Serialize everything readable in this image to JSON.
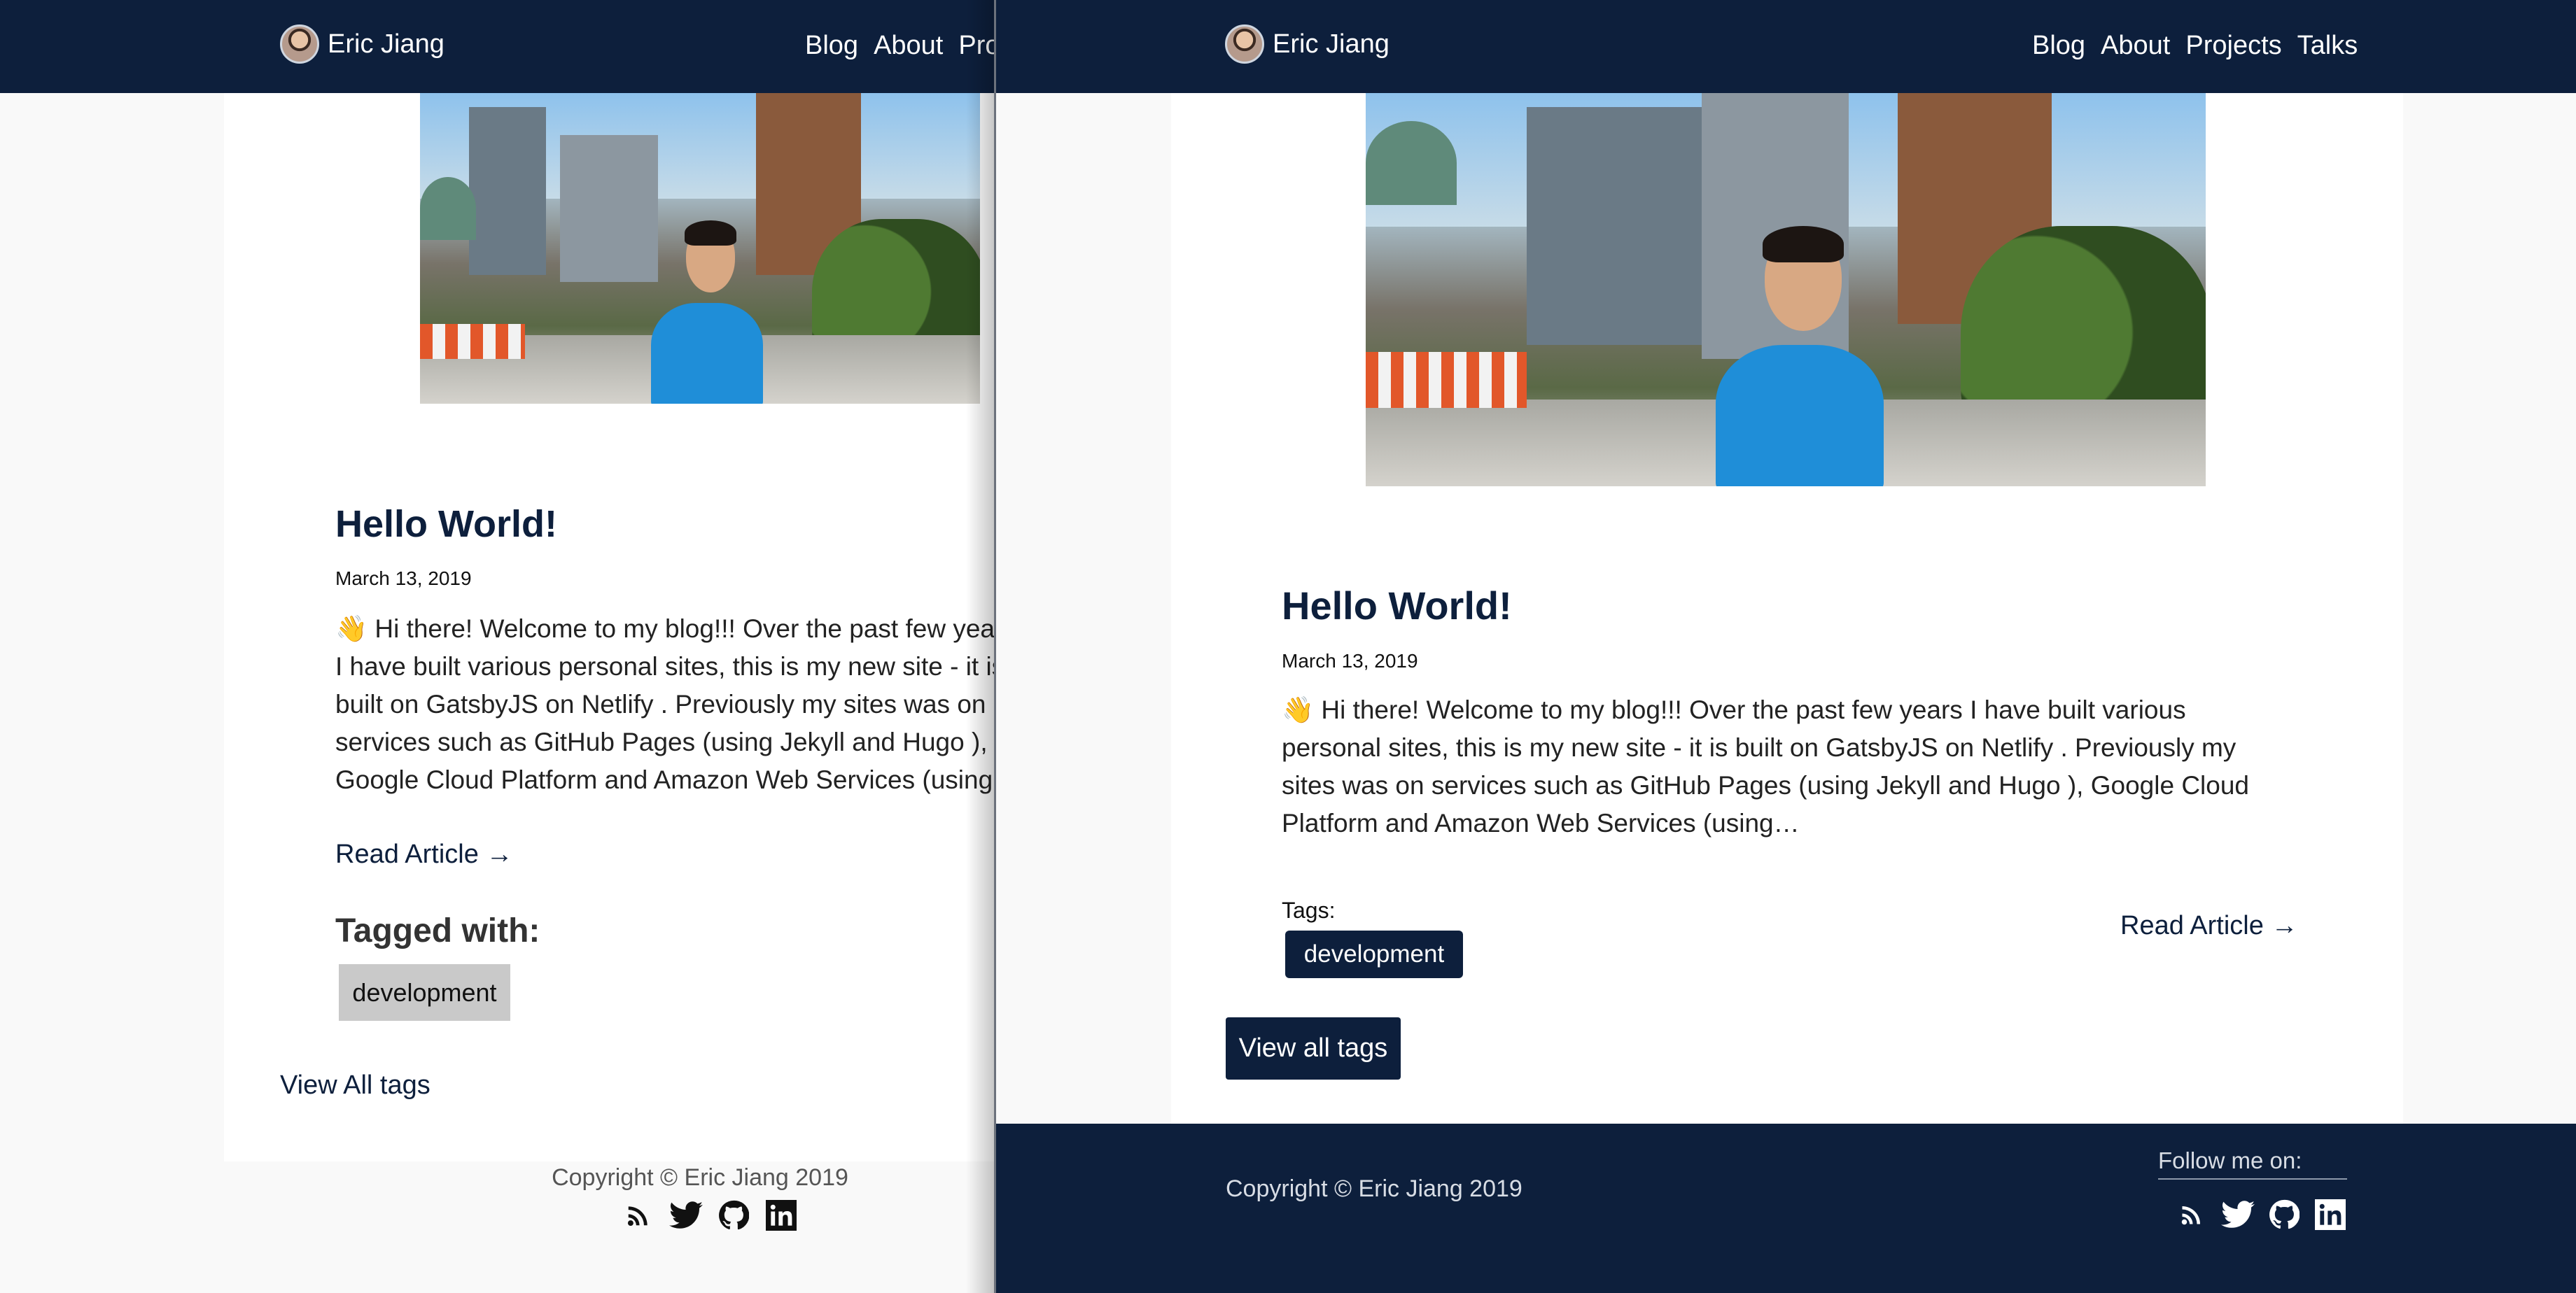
{
  "theme": {
    "navy": "#0d1f3c",
    "page_bg": "#f9f9f9",
    "card_bg": "#ffffff",
    "old_tag_bg": "#c9c9c9"
  },
  "old_page": {
    "site": {
      "name": "Eric Jiang"
    },
    "nav": {
      "blog": "Blog",
      "about": "About",
      "projects": "Projects"
    },
    "post": {
      "title": "Hello World!",
      "date": "March 13, 2019",
      "excerpt": "👋 Hi there! Welcome to my blog!!! Over the past few years I have built various personal sites, this is my new site - it is built on GatsbyJS on Netlify . Previously my sites was on services such as GitHub Pages (using Jekyll and Hugo ), Google Cloud Platform and Amazon Web Services (using…",
      "read_more": "Read Article →"
    },
    "tagged_heading": "Tagged with:",
    "tags": [
      "development"
    ],
    "view_all": "View All tags",
    "footer": {
      "copyright": "Copyright © Eric Jiang 2019",
      "socials": [
        "rss-icon",
        "twitter-icon",
        "github-icon",
        "linkedin-icon"
      ]
    }
  },
  "new_page": {
    "site": {
      "name": "Eric Jiang"
    },
    "nav": {
      "blog": "Blog",
      "about": "About",
      "projects": "Projects",
      "talks": "Talks"
    },
    "post": {
      "title": "Hello World!",
      "date": "March 13, 2019",
      "excerpt": "👋 Hi there! Welcome to my blog!!! Over the past few years I have built various personal sites, this is my new site - it is built on GatsbyJS on Netlify . Previously my sites was on services such as GitHub Pages (using Jekyll and Hugo ), Google Cloud Platform and Amazon Web Services (using…",
      "read_more": "Read Article →"
    },
    "tags_label": "Tags:",
    "tags": [
      "development"
    ],
    "view_all": "View all tags",
    "footer": {
      "copyright": "Copyright © Eric Jiang 2019",
      "follow": "Follow me on:",
      "socials": [
        "rss-icon",
        "twitter-icon",
        "github-icon",
        "linkedin-icon"
      ]
    }
  }
}
